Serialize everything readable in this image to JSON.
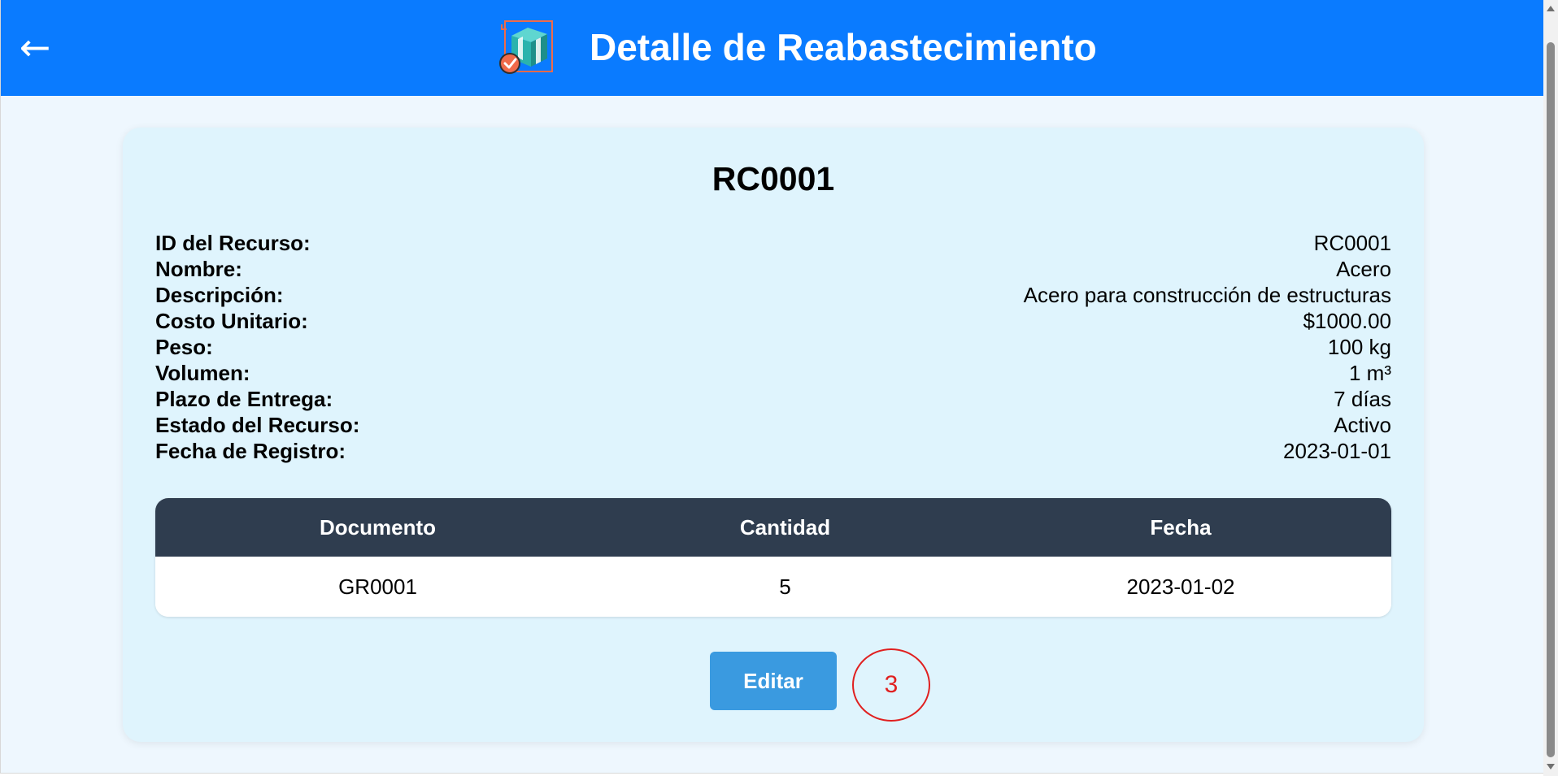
{
  "header": {
    "back_label": "←",
    "title": "Detalle de Reabastecimiento",
    "logo_icon": "package-check-icon"
  },
  "record": {
    "title": "RC0001",
    "details": [
      {
        "label": "ID del Recurso:",
        "value": "RC0001"
      },
      {
        "label": "Nombre:",
        "value": "Acero"
      },
      {
        "label": "Descripción:",
        "value": "Acero para construcción de estructuras"
      },
      {
        "label": "Costo Unitario:",
        "value": "$1000.00"
      },
      {
        "label": "Peso:",
        "value": "100 kg"
      },
      {
        "label": "Volumen:",
        "value": "1 m³"
      },
      {
        "label": "Plazo de Entrega:",
        "value": "7 días"
      },
      {
        "label": "Estado del Recurso:",
        "value": "Activo"
      },
      {
        "label": "Fecha de Registro:",
        "value": "2023-01-01"
      }
    ]
  },
  "table": {
    "headers": [
      "Documento",
      "Cantidad",
      "Fecha"
    ],
    "rows": [
      [
        "GR0001",
        "5",
        "2023-01-02"
      ]
    ]
  },
  "actions": {
    "edit_label": "Editar"
  },
  "annotation": {
    "label": "3",
    "color": "#e02020"
  },
  "colors": {
    "header_bg": "#0a7bff",
    "card_bg": "#dff4fd",
    "table_header_bg": "#2f3d4f",
    "button_bg": "#3a9ae0"
  }
}
